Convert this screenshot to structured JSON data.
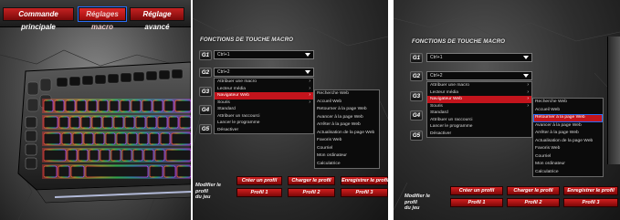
{
  "panel1": {
    "tabs": [
      {
        "label": "Commande principale",
        "active": false
      },
      {
        "label": "Réglages macro",
        "active": true
      },
      {
        "label": "Réglage avancé",
        "active": false
      }
    ]
  },
  "macro_title": "FONCTIONS DE TOUCHE MACRO",
  "g_keys": [
    "G1",
    "G2",
    "G3",
    "G4",
    "G5"
  ],
  "selectors": {
    "g1_value": "Ctrl+1",
    "g2_value": "Ctrl+2"
  },
  "context_menu": [
    {
      "label": "Attribuer une macro",
      "submenu": true
    },
    {
      "label": "Lecteur média",
      "submenu": true
    },
    {
      "label": "Navigateur Web",
      "submenu": true,
      "selected": true
    },
    {
      "label": "Souris",
      "submenu": true
    },
    {
      "label": "Standard",
      "submenu": false
    },
    {
      "label": "Attribuer un raccourci",
      "submenu": false
    },
    {
      "label": "Lancer le programme",
      "submenu": false
    },
    {
      "label": "Désactiver",
      "submenu": false
    }
  ],
  "web_submenu": [
    "Recherche Web",
    "Accueil Web",
    "Retourner à la page Web",
    "Avancer à la page Web",
    "Arrêter à la page Web",
    "Actualisation de la page Web",
    "Favoris Web",
    "Courriel",
    "Mon ordinateur",
    "Calculatrice"
  ],
  "panel2_submenu_selected": -1,
  "panel3_submenu_selected": 2,
  "profile": {
    "modify_label_line1": "Modifier le profil",
    "modify_label_line2": "du jeu",
    "create": "Créer un profil",
    "load": "Charger le profil",
    "save": "Enregistrer le profil",
    "profiles": [
      "Profil 1",
      "Profil 2",
      "Profil 3"
    ]
  },
  "colors": {
    "accent_red": "#c3141c",
    "focus_blue": "#2a6df4"
  }
}
